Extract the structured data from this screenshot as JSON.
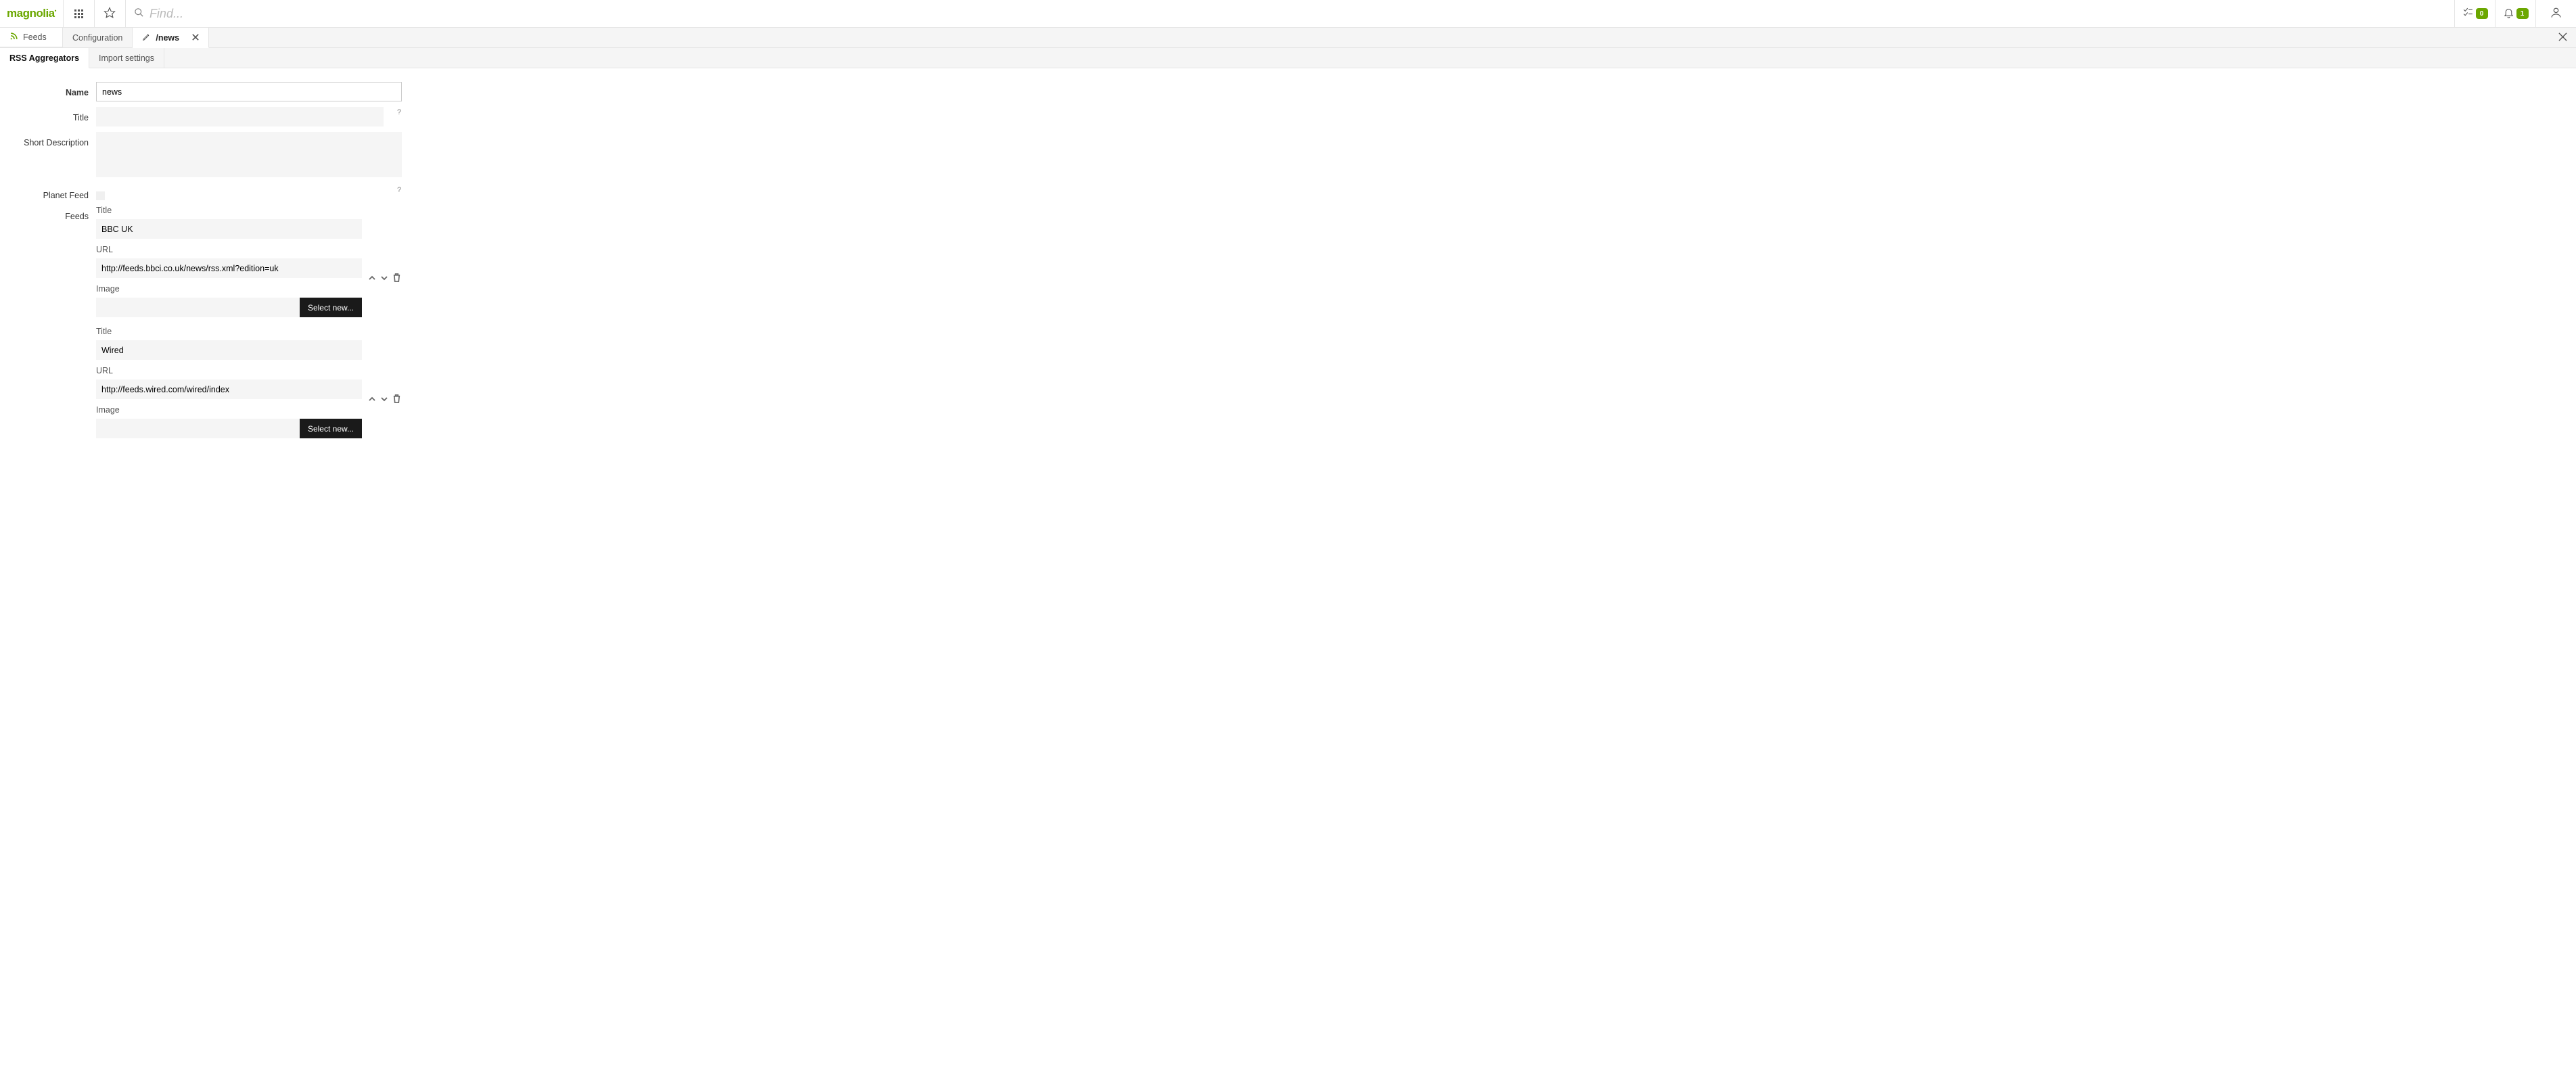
{
  "header": {
    "logo": "magnolia",
    "search_placeholder": "Find...",
    "tasks_count": "0",
    "notifications_count": "1"
  },
  "appTabs": {
    "feeds": "Feeds",
    "configuration": "Configuration",
    "editing": "/news"
  },
  "subTabs": {
    "rss_aggregators": "RSS Aggregators",
    "import_settings": "Import settings"
  },
  "form": {
    "labels": {
      "name": "Name",
      "title": "Title",
      "short_description": "Short Description",
      "planet_feed": "Planet Feed",
      "feeds": "Feeds"
    },
    "values": {
      "name": "news",
      "title": "",
      "short_description": "",
      "planet_feed": false
    },
    "help": "?",
    "feed_sublabels": {
      "title": "Title",
      "url": "URL",
      "image": "Image"
    },
    "select_new_label": "Select new...",
    "feeds": [
      {
        "title": "BBC UK",
        "url": "http://feeds.bbci.co.uk/news/rss.xml?edition=uk",
        "image": ""
      },
      {
        "title": "Wired",
        "url": "http://feeds.wired.com/wired/index",
        "image": ""
      }
    ]
  }
}
